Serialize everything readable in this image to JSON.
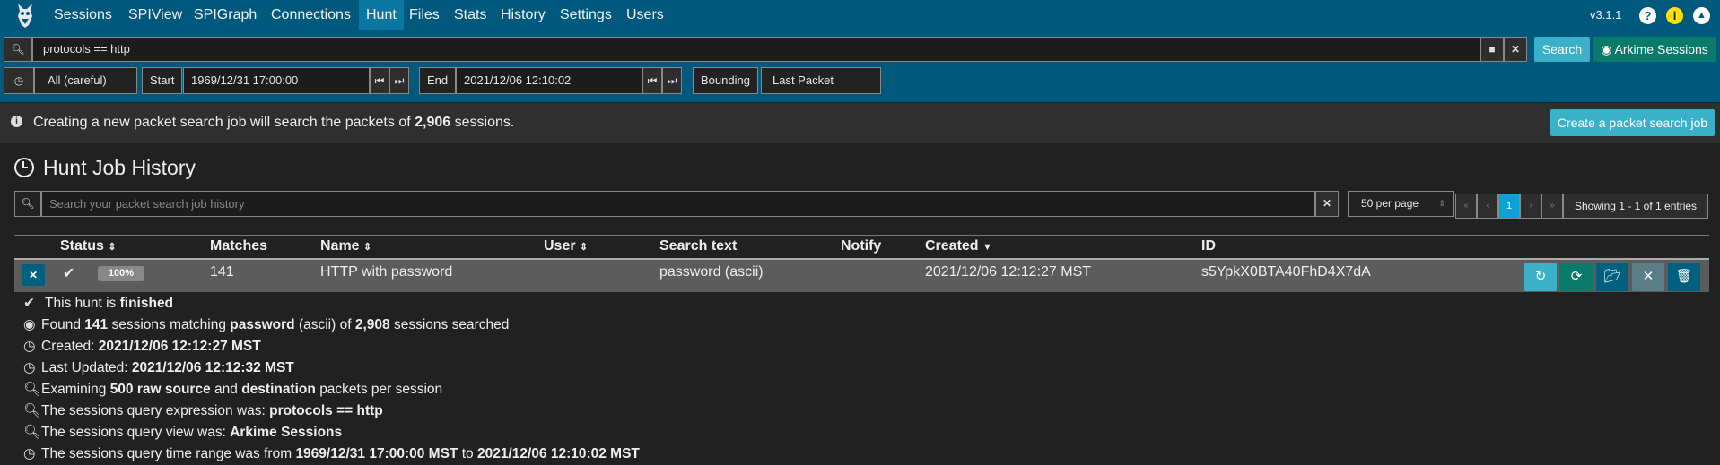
{
  "nav": {
    "items": [
      "Sessions",
      "SPIView",
      "SPIGraph",
      "Connections",
      "Hunt",
      "Files",
      "Stats",
      "History",
      "Settings",
      "Users"
    ],
    "active": "Hunt",
    "version": "v3.1.1"
  },
  "search": {
    "expression": "protocols == http",
    "button_label": "Search",
    "view_label": "Arkime Sessions"
  },
  "time": {
    "range_label": "All (careful)",
    "start_label": "Start",
    "start_value": "1969/12/31 17:00:00",
    "end_label": "End",
    "end_value": "2021/12/06 12:10:02",
    "bounding_label": "Bounding",
    "bounding_value": "Last Packet"
  },
  "info": {
    "text_prefix": "Creating a new packet search job will search the packets of",
    "count": "2,906",
    "text_suffix": "sessions.",
    "create_button": "Create a packet search job"
  },
  "history": {
    "title": "Hunt Job History",
    "search_placeholder": "Search your packet search job history",
    "per_page": "50 per page",
    "pages": [
      "«",
      "‹",
      "1",
      "›",
      "»"
    ],
    "current_page": "1",
    "showing": "Showing 1 - 1 of 1 entries",
    "columns": [
      "Status",
      "Matches",
      "Name",
      "User",
      "Search text",
      "Notify",
      "Created",
      "ID"
    ],
    "rows": [
      {
        "progress": "100%",
        "matches": "141",
        "name": "HTTP with password",
        "user": "",
        "search_text": "password (ascii)",
        "notify": "",
        "created": "2021/12/06 12:12:27 MST",
        "id": "s5YpkX0BTA40FhD4X7dA"
      }
    ]
  },
  "details": {
    "l1_a": "This hunt is",
    "l1_b": "finished",
    "l2_a": "Found",
    "l2_b": "141",
    "l2_c": "sessions matching",
    "l2_d": "password",
    "l2_e": "(ascii) of",
    "l2_f": "2,908",
    "l2_g": "sessions searched",
    "l3_a": "Created:",
    "l3_b": "2021/12/06 12:12:27 MST",
    "l4_a": "Last Updated:",
    "l4_b": "2021/12/06 12:12:32 MST",
    "l5_a": "Examining",
    "l5_b": "500 raw source",
    "l5_c": "and",
    "l5_d": "destination",
    "l5_e": "packets per session",
    "l6_a": "The sessions query expression was:",
    "l6_b": "protocols == http",
    "l7_a": "The sessions query view was:",
    "l7_b": "Arkime Sessions",
    "l8_a": "The sessions query time range was from",
    "l8_b": "1969/12/31 17:00:00 MST",
    "l8_c": "to",
    "l8_d": "2021/12/06 12:10:02 MST"
  },
  "colors": {
    "navbar": "#00587c",
    "accent": "#0a77a3",
    "search_button": "#3ab0c9",
    "view_button": "#0a7a6a",
    "background": "#212121"
  }
}
